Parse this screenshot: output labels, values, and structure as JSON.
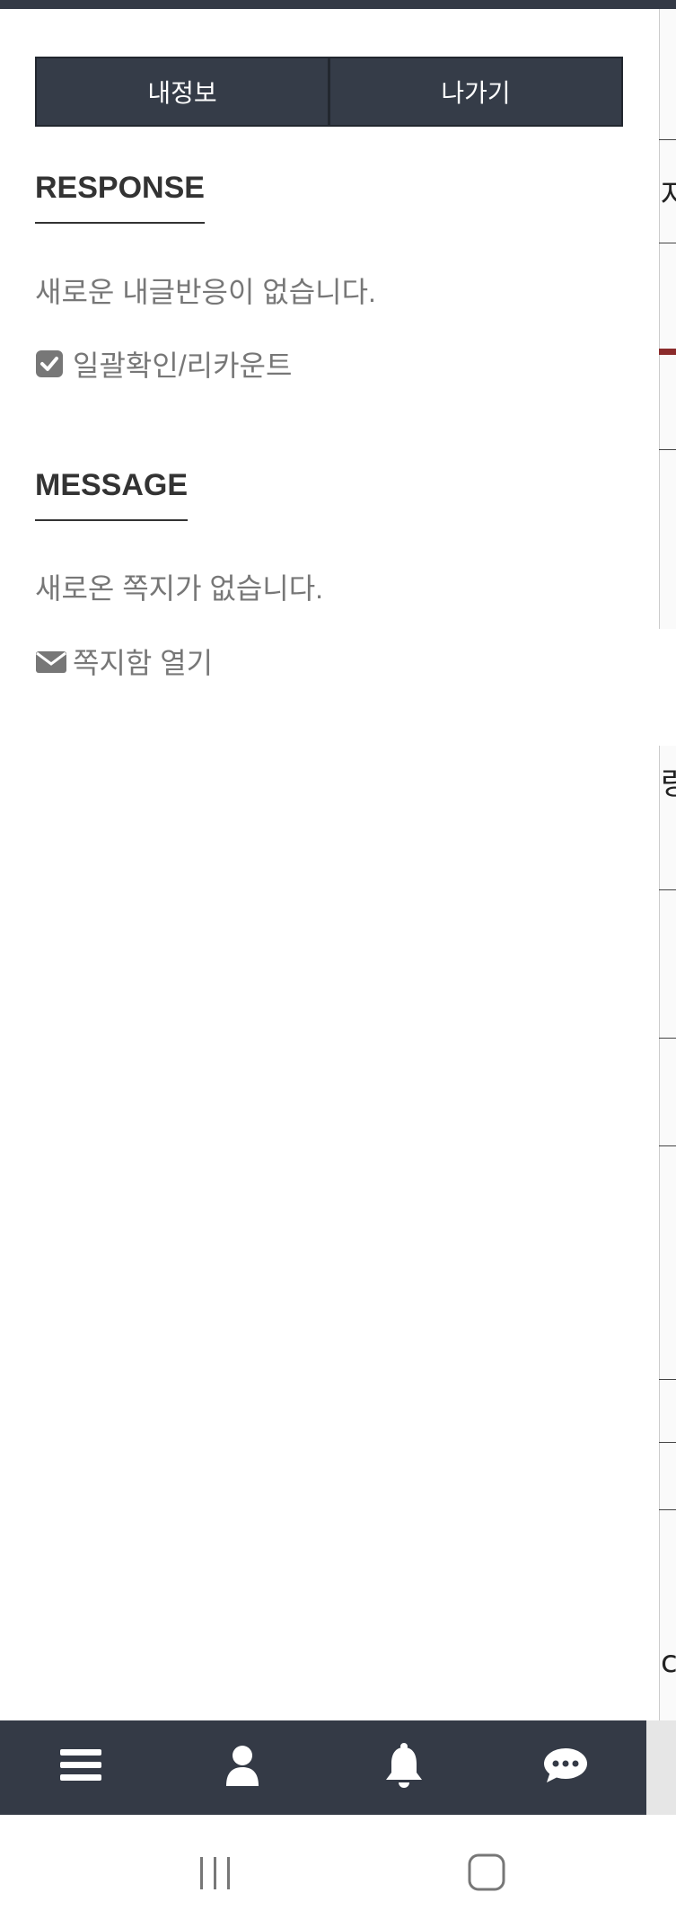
{
  "drawer": {
    "buttons": {
      "my_info_label": "내정보",
      "exit_label": "나가기"
    },
    "response": {
      "title": "RESPONSE",
      "message": "새로운 내글반응이 없습니다.",
      "action_label": "일괄확인/리카운트",
      "action_icon": "check-square-icon"
    },
    "message": {
      "title": "MESSAGE",
      "text": "새로온 쪽지가 없습니다.",
      "action_label": "쪽지함 열기",
      "action_icon": "envelope-icon"
    }
  },
  "background_page": {
    "visible_fragments": [
      "자",
      "랑",
      "c"
    ]
  },
  "bottom_nav": {
    "items": [
      {
        "icon": "menu-icon"
      },
      {
        "icon": "user-icon"
      },
      {
        "icon": "bell-icon"
      },
      {
        "icon": "chat-icon"
      }
    ]
  },
  "system_nav": {
    "items": [
      {
        "icon": "recent-apps-icon"
      },
      {
        "icon": "home-icon"
      }
    ]
  },
  "colors": {
    "dark_bar": "#343a46",
    "muted_text": "#777777",
    "heading_text": "#333333"
  }
}
